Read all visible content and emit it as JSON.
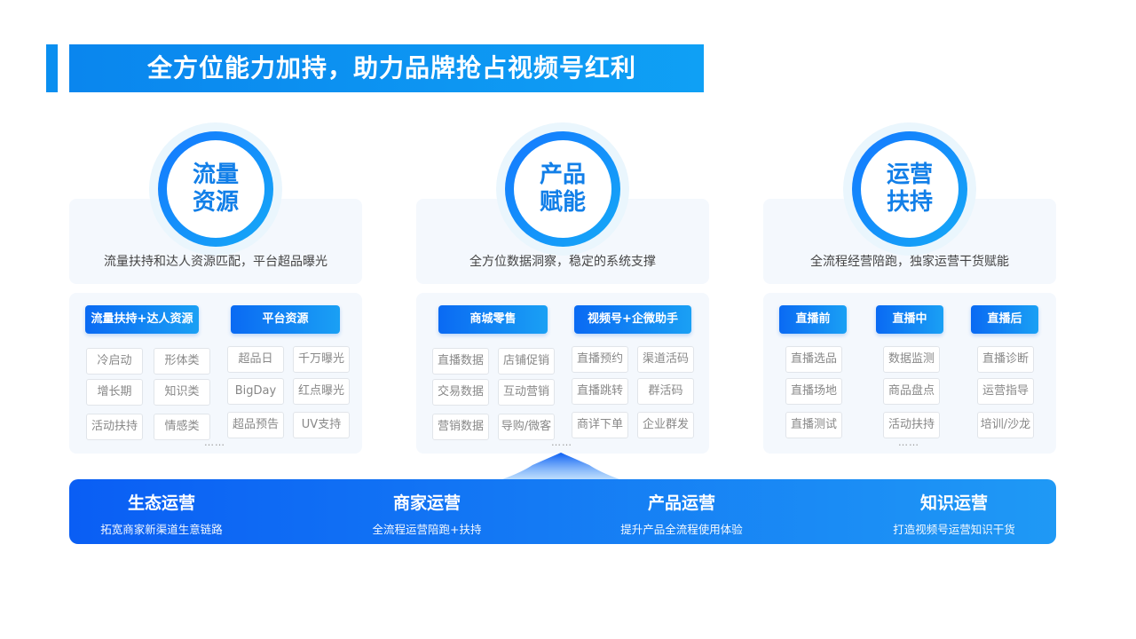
{
  "title": "全方位能力加持，助力品牌抢占视频号红利",
  "columns": [
    {
      "circle_line1": "流量",
      "circle_line2": "资源",
      "desc": "流量扶持和达人资源匹配，平台超品曝光",
      "categories": [
        "流量扶持+达人资源",
        "平台资源"
      ],
      "tags": [
        "冷启动",
        "形体类",
        "超品日",
        "千万曝光",
        "增长期",
        "知识类",
        "BigDay",
        "红点曝光",
        "活动扶持",
        "情感类",
        "超品预告",
        "UV支持"
      ],
      "ellipsis": "……"
    },
    {
      "circle_line1": "产品",
      "circle_line2": "赋能",
      "desc": "全方位数据洞察，稳定的系统支撑",
      "categories": [
        "商城零售",
        "视频号+企微助手"
      ],
      "tags": [
        "直播数据",
        "店铺促销",
        "直播预约",
        "渠道活码",
        "交易数据",
        "互动营销",
        "直播跳转",
        "群活码",
        "营销数据",
        "导购/微客",
        "商详下单",
        "企业群发"
      ],
      "ellipsis": "……"
    },
    {
      "circle_line1": "运营",
      "circle_line2": "扶持",
      "desc": "全流程经营陪跑，独家运营干货赋能",
      "categories": [
        "直播前",
        "直播中",
        "直播后"
      ],
      "tags": [
        "直播选品",
        "数据监测",
        "直播诊断",
        "直播场地",
        "商品盘点",
        "运营指导",
        "直播测试",
        "活动扶持",
        "培训/沙龙"
      ],
      "ellipsis": "……"
    }
  ],
  "bottom": [
    {
      "title": "生态运营",
      "sub": "拓宽商家新渠道生意链路"
    },
    {
      "title": "商家运营",
      "sub": "全流程运营陪跑+扶持"
    },
    {
      "title": "产品运营",
      "sub": "提升产品全流程使用体验"
    },
    {
      "title": "知识运营",
      "sub": "打造视频号运营知识干货"
    }
  ],
  "colors": {
    "primary": "#0a86ee",
    "accent": "#127fe8",
    "card_bg": "#f4f8fd"
  }
}
